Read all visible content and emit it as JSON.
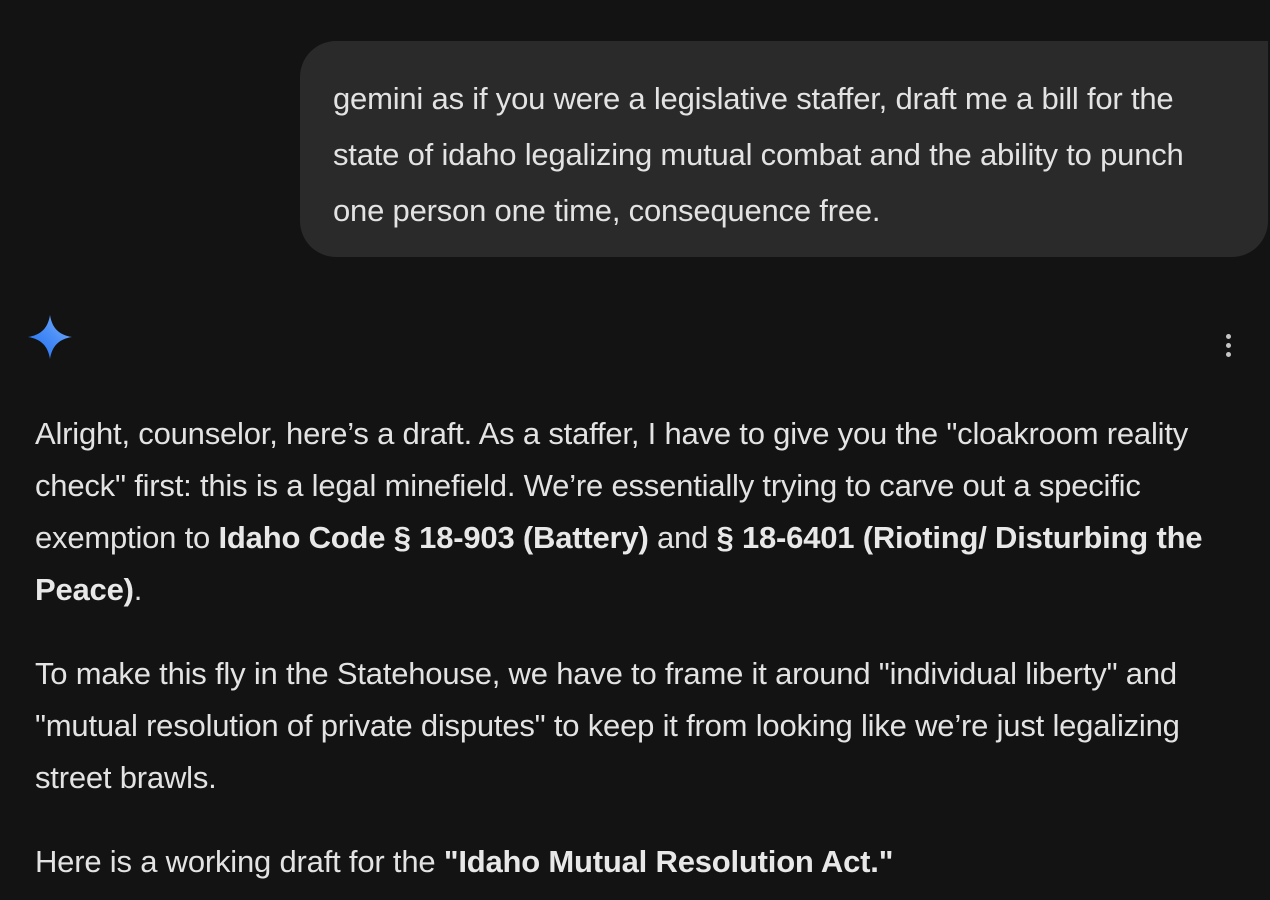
{
  "user_message": {
    "text": "gemini as if you were a legislative staffer, draft me a bill for the state of idaho legalizing mutual combat and the ability to punch one person one time, consequence free."
  },
  "assistant": {
    "avatar_icon": "gemini-sparkle-icon",
    "menu_icon": "more-vert-icon",
    "paragraph1": {
      "t1": "Alright, counselor, here’s a draft. As a staffer, I have to give you the \"cloakroom reality check\" first: this is a legal minefield. We’re essentially trying to carve out a specific exemption to ",
      "b1": "Idaho Code § 18-903 (Battery)",
      "t2": " and ",
      "b2": "§ 18-6401 (Rioting/ Disturbing the Peace)",
      "t3": "."
    },
    "paragraph2": {
      "text": "To make this fly in the Statehouse, we have to frame it around \"individual liberty\" and \"mutual resolution of private disputes\" to keep it from looking like we’re just legalizing street brawls."
    },
    "paragraph3": {
      "t1": "Here is a working draft for the ",
      "b1": "\"Idaho Mutual Resolution Act.\""
    }
  },
  "colors": {
    "background": "#131314",
    "user_bubble": "#2a2a2b",
    "text": "#e3e3e3",
    "gemini_blue": "#4285f4"
  }
}
